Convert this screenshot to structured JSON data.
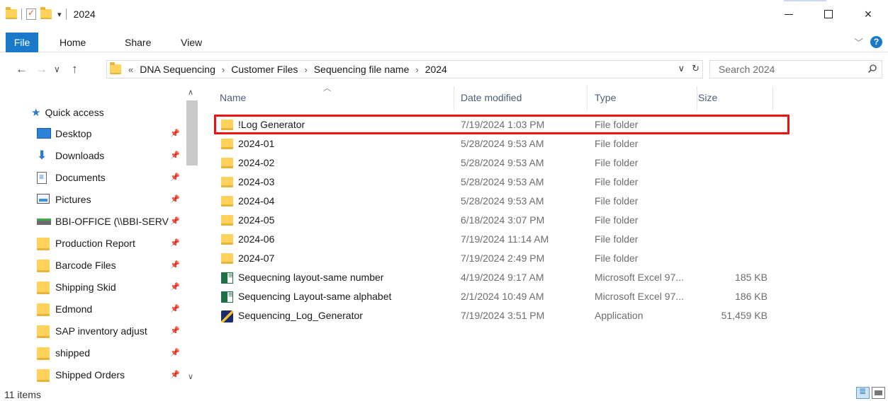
{
  "window": {
    "title": "2024",
    "controls": {
      "minimize": "minimize",
      "maximize": "maximize",
      "close": "×"
    }
  },
  "ribbon": {
    "tabs": [
      "File",
      "Home",
      "Share",
      "View"
    ],
    "help_label": "?"
  },
  "addressbar": {
    "overflow": "«",
    "breadcrumbs": [
      "DNA Sequencing",
      "Customer Files",
      "Sequencing file name",
      "2024"
    ],
    "search_placeholder": "Search 2024"
  },
  "navpane": {
    "quick_access": "Quick access",
    "items": [
      {
        "label": "Desktop",
        "icon": "desktop-icon",
        "pinned": true
      },
      {
        "label": "Downloads",
        "icon": "downloads-icon",
        "pinned": true
      },
      {
        "label": "Documents",
        "icon": "documents-icon",
        "pinned": true
      },
      {
        "label": "Pictures",
        "icon": "pictures-icon",
        "pinned": true
      },
      {
        "label": "BBI-OFFICE (\\\\BBI-SERV",
        "icon": "network-drive-icon",
        "pinned": true
      },
      {
        "label": "Production Report",
        "icon": "folder-icon",
        "pinned": true
      },
      {
        "label": "Barcode Files",
        "icon": "folder-icon",
        "pinned": true
      },
      {
        "label": "Shipping Skid",
        "icon": "folder-icon",
        "pinned": true
      },
      {
        "label": "Edmond",
        "icon": "folder-icon",
        "pinned": true
      },
      {
        "label": "SAP inventory adjust",
        "icon": "folder-icon",
        "pinned": true
      },
      {
        "label": "shipped",
        "icon": "folder-icon",
        "pinned": true
      },
      {
        "label": "Shipped Orders",
        "icon": "folder-icon",
        "pinned": true
      }
    ]
  },
  "filelist": {
    "columns": {
      "name": "Name",
      "date": "Date modified",
      "type": "Type",
      "size": "Size"
    },
    "rows": [
      {
        "name": "!Log Generator",
        "date": "7/19/2024 1:03 PM",
        "type": "File folder",
        "size": "",
        "icon": "folder-icon",
        "highlighted": true
      },
      {
        "name": "2024-01",
        "date": "5/28/2024 9:53 AM",
        "type": "File folder",
        "size": "",
        "icon": "folder-icon"
      },
      {
        "name": "2024-02",
        "date": "5/28/2024 9:53 AM",
        "type": "File folder",
        "size": "",
        "icon": "folder-icon"
      },
      {
        "name": "2024-03",
        "date": "5/28/2024 9:53 AM",
        "type": "File folder",
        "size": "",
        "icon": "folder-icon"
      },
      {
        "name": "2024-04",
        "date": "5/28/2024 9:53 AM",
        "type": "File folder",
        "size": "",
        "icon": "folder-icon"
      },
      {
        "name": "2024-05",
        "date": "6/18/2024 3:07 PM",
        "type": "File folder",
        "size": "",
        "icon": "folder-icon"
      },
      {
        "name": "2024-06",
        "date": "7/19/2024 11:14 AM",
        "type": "File folder",
        "size": "",
        "icon": "folder-icon"
      },
      {
        "name": "2024-07",
        "date": "7/19/2024 2:49 PM",
        "type": "File folder",
        "size": "",
        "icon": "folder-icon"
      },
      {
        "name": "Sequecning layout-same number",
        "date": "4/19/2024 9:17 AM",
        "type": "Microsoft Excel 97...",
        "size": "185 KB",
        "icon": "excel-icon"
      },
      {
        "name": "Sequencing Layout-same alphabet",
        "date": "2/1/2024 10:49 AM",
        "type": "Microsoft Excel 97...",
        "size": "186 KB",
        "icon": "excel-icon"
      },
      {
        "name": "Sequencing_Log_Generator",
        "date": "7/19/2024 3:51 PM",
        "type": "Application",
        "size": "51,459 KB",
        "icon": "application-icon"
      }
    ]
  },
  "statusbar": {
    "count": "11 items"
  },
  "colors": {
    "accent": "#1979ca",
    "highlight": "#ee0f0f",
    "folder": "#ffd35b"
  }
}
